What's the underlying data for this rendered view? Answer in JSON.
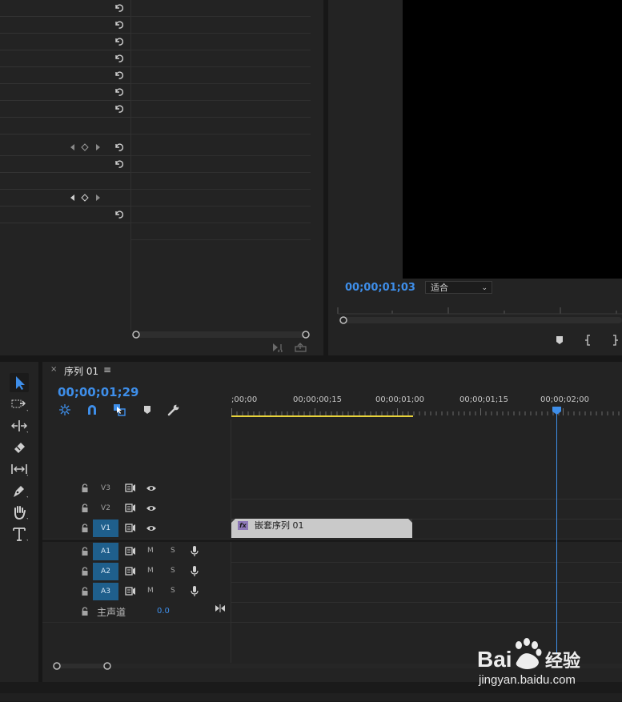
{
  "program_monitor": {
    "timecode": "00;00;01;03",
    "fit_label": "适合"
  },
  "timeline": {
    "tab_close": "×",
    "sequence_name": "序列 01",
    "tab_menu": "≡",
    "timecode": "00;00;01;29",
    "ruler_labels": [
      ";00;00",
      "00;00;00;15",
      "00;00;01;00",
      "00;00;01;15",
      "00;00;02;00"
    ],
    "video_tracks": [
      "V3",
      "V2",
      "V1"
    ],
    "audio_tracks": [
      "A1",
      "A2",
      "A3"
    ],
    "mute_label": "M",
    "solo_label": "S",
    "master_label": "主声道",
    "master_value": "0.0",
    "clip_label": "嵌套序列 01",
    "clip_fx": "fx"
  },
  "watermark": {
    "logo_text": "Bai 经验",
    "url": "jingyan.baidu.com"
  },
  "colors": {
    "accent": "#3e8ee9",
    "track_target": "#1f5f8c",
    "work_area": "#e8d33b",
    "clip": "#c9c9c9"
  }
}
